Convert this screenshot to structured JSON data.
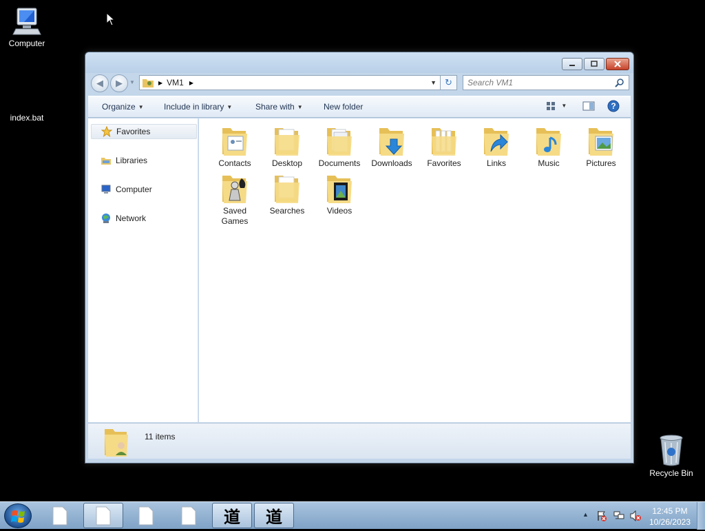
{
  "desktop": {
    "icons": [
      {
        "label": "Computer",
        "icon": "computer-icon"
      },
      {
        "label": "index.bat",
        "icon": "batch-file-icon"
      },
      {
        "label": "Recycle Bin",
        "icon": "recycle-bin-icon"
      }
    ]
  },
  "window": {
    "breadcrumb": [
      "VM1"
    ],
    "search_placeholder": "Search VM1",
    "toolbar": {
      "organize": "Organize",
      "include_in_library": "Include in library",
      "share_with": "Share with",
      "new_folder": "New folder"
    },
    "nav": {
      "favorites": "Favorites",
      "libraries": "Libraries",
      "computer": "Computer",
      "network": "Network"
    },
    "folders": [
      {
        "name": "Contacts",
        "icon": "contacts-folder-icon"
      },
      {
        "name": "Desktop",
        "icon": "desktop-folder-icon"
      },
      {
        "name": "Documents",
        "icon": "documents-folder-icon"
      },
      {
        "name": "Downloads",
        "icon": "downloads-folder-icon"
      },
      {
        "name": "Favorites",
        "icon": "favorites-folder-icon"
      },
      {
        "name": "Links",
        "icon": "links-folder-icon"
      },
      {
        "name": "Music",
        "icon": "music-folder-icon"
      },
      {
        "name": "Pictures",
        "icon": "pictures-folder-icon"
      },
      {
        "name": "Saved Games",
        "icon": "saved-games-folder-icon"
      },
      {
        "name": "Searches",
        "icon": "searches-folder-icon"
      },
      {
        "name": "Videos",
        "icon": "videos-folder-icon"
      }
    ],
    "status": {
      "item_count": "11 items"
    }
  },
  "taskbar": {
    "buttons": [
      "document-icon",
      "document-icon",
      "document-icon",
      "document-icon",
      "kanji-app-icon",
      "kanji-app-icon"
    ],
    "kanji_glyph": "道",
    "clock": {
      "time": "12:45 PM",
      "date": "10/26/2023"
    }
  },
  "colors": {
    "accent": "#3a78c2",
    "folder": "#f3d77e",
    "taskbar": "#8fb0d0"
  }
}
